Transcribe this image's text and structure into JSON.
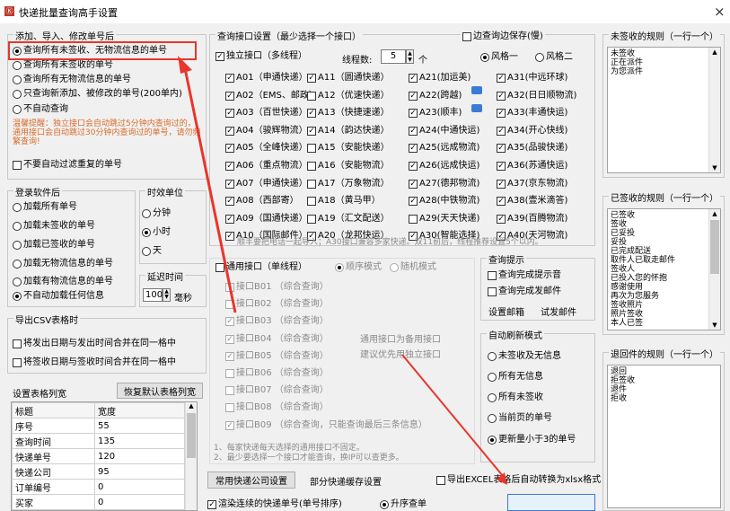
{
  "window": {
    "title": "快递批量查询高手设置",
    "close": "×"
  },
  "import": {
    "title": "添加、导入、修改单号后",
    "options": [
      {
        "label": "查询所有未签收、无物流信息的单号",
        "on": true
      },
      {
        "label": "查询所有未签收的单号",
        "on": false
      },
      {
        "label": "查询所有无物流信息的单号",
        "on": false
      },
      {
        "label": "只查询新添加、被修改的单号(200单内)",
        "on": false
      },
      {
        "label": "不自动查询",
        "on": false
      }
    ],
    "warning": "温馨提醒：独立接口会自动跳过5分钟内查询过的，通用接口会自动跳过30分钟内查询过的单号，请勿频繁查询!",
    "nofilter": "不要自动过滤重复的单号"
  },
  "login": {
    "title": "登录软件后",
    "options": [
      {
        "label": "加载所有单号",
        "on": false
      },
      {
        "label": "加载未签收的单号",
        "on": false
      },
      {
        "label": "加载已签收的单号",
        "on": false
      },
      {
        "label": "加载无物流信息的单号",
        "on": false
      },
      {
        "label": "加载有物流信息的单号",
        "on": false
      },
      {
        "label": "不自动加载任何信息",
        "on": true
      }
    ]
  },
  "time": {
    "title": "时效单位",
    "options": [
      {
        "label": "分钟",
        "on": false
      },
      {
        "label": "小时",
        "on": true
      },
      {
        "label": "天",
        "on": false
      }
    ]
  },
  "delay": {
    "title": "延迟时间",
    "value": "100",
    "unit": "毫秒"
  },
  "csv": {
    "title": "导出CSV表格时",
    "opt1": "将发出日期与发出时间合并在同一格中",
    "opt2": "将签收日期与签收时间合并在同一格中"
  },
  "cols": {
    "title": "设置表格列宽",
    "reset": "恢复默认表格列宽",
    "headers": [
      "标题",
      "宽度"
    ],
    "rows": [
      [
        "序号",
        "55"
      ],
      [
        "查询时间",
        "135"
      ],
      [
        "快递单号",
        "120"
      ],
      [
        "快递公司",
        "95"
      ],
      [
        "订单编号",
        "0"
      ],
      [
        "买家",
        "0"
      ]
    ]
  },
  "api": {
    "title": "查询接口设置（最少选择一个接口）",
    "edge": "边查询边保存(慢)",
    "indep": "独立接口（多线程）",
    "threads_label": "线程数:",
    "threads": "5",
    "threads_unit": "个",
    "style1": "风格一",
    "style2": "风格二",
    "cols": [
      [
        {
          "l": "A01（申通快递）",
          "c": true
        },
        {
          "l": "A02（EMS、邮政）",
          "c": true
        },
        {
          "l": "A03（百世快递）",
          "c": true
        },
        {
          "l": "A04（骏辉物流）",
          "c": true
        },
        {
          "l": "A05（全峰快递）",
          "c": true
        },
        {
          "l": "A06（重点物流）",
          "c": true
        },
        {
          "l": "A07（申通快递）",
          "c": true
        },
        {
          "l": "A08（西部寄）",
          "c": true
        },
        {
          "l": "A09（国通快递）",
          "c": true
        },
        {
          "l": "A10（国际邮件）",
          "c": true
        }
      ],
      [
        {
          "l": "A11（圆通快递）",
          "c": true
        },
        {
          "l": "A12（优速快递）",
          "c": false
        },
        {
          "l": "A13（快捷速递）",
          "c": true
        },
        {
          "l": "A14（韵达快递）",
          "c": true
        },
        {
          "l": "A15（安能快递）",
          "c": false
        },
        {
          "l": "A16（安能物流）",
          "c": false
        },
        {
          "l": "A17（万象物流）",
          "c": false
        },
        {
          "l": "A18（黄马甲）",
          "c": false
        },
        {
          "l": "A19（汇文配送）",
          "c": false
        },
        {
          "l": "A20（龙邦快运）",
          "c": true
        }
      ],
      [
        {
          "l": "A21(加运美)",
          "c": true
        },
        {
          "l": "A22(跨越)",
          "c": true
        },
        {
          "l": "A23(顺丰)",
          "c": true
        },
        {
          "l": "A24(中通快运)",
          "c": true
        },
        {
          "l": "A25(远成物流)",
          "c": true
        },
        {
          "l": "A26(远成快运)",
          "c": true
        },
        {
          "l": "A27(德邦物流)",
          "c": true
        },
        {
          "l": "A28(中铁物流)",
          "c": true
        },
        {
          "l": "A29(天天快递)",
          "c": false
        },
        {
          "l": "A30(智能选择)",
          "c": true
        }
      ],
      [
        {
          "l": "A31(中远环球)",
          "c": true
        },
        {
          "l": "A32(日日顺物流)",
          "c": true
        },
        {
          "l": "A33(丰通快运)",
          "c": true
        },
        {
          "l": "A34(开心快线)",
          "c": true
        },
        {
          "l": "A35(品骏快递)",
          "c": true
        },
        {
          "l": "A36(苏通快运)",
          "c": true
        },
        {
          "l": "A37(京东物流)",
          "c": true
        },
        {
          "l": "A38(壹米滴答)",
          "c": true
        },
        {
          "l": "A39(百腾物流)",
          "c": true
        },
        {
          "l": "A40(天河物流)",
          "c": true
        }
      ]
    ],
    "note": "顺丰要把电话一起导入；A30接口兼容多家快递。双11前后，线程推荐设置5个以内。"
  },
  "general": {
    "title": "通用接口（单线程）",
    "mode1": "顺序模式",
    "mode2": "随机模式",
    "items": [
      {
        "l": "接口B01 （综合查询）",
        "c": false
      },
      {
        "l": "接口B02 （综合查询）",
        "c": false
      },
      {
        "l": "接口B03 （综合查询）",
        "c": true
      },
      {
        "l": "接口B04 （综合查询）",
        "c": true
      },
      {
        "l": "接口B05 （综合查询）",
        "c": true
      },
      {
        "l": "接口B06 （综合查询）",
        "c": false
      },
      {
        "l": "接口B07 （综合查询）",
        "c": false
      },
      {
        "l": "接口B08 （综合查询）",
        "c": false
      },
      {
        "l": "接口B09 （综合查询，只能查询最后三条信息）",
        "c": true
      }
    ],
    "tip1": "通用接口为备用接口",
    "tip2": "建议优先用独立接口",
    "foot1": "1、每家快递每天选择的通用接口不固定。",
    "foot2": "2、最少要选择一个接口才能查询，换IP可以查更多。"
  },
  "hint": {
    "title": "查询提示",
    "opt1": "查询完成提示音",
    "opt2": "查询完成发邮件",
    "btn1": "设置邮箱",
    "btn2": "试发邮件"
  },
  "auto": {
    "title": "自动刷新模式",
    "options": [
      {
        "label": "未签收及无信息",
        "on": false
      },
      {
        "label": "所有无信息",
        "on": false
      },
      {
        "label": "所有未签收",
        "on": false
      },
      {
        "label": "当前页的单号",
        "on": false
      },
      {
        "label": "更新量小于3的单号",
        "on": true
      }
    ]
  },
  "bottom": {
    "btn_common": "常用快递公司设置",
    "partial": "部分快递缓存设置",
    "excel": "导出EXCEL表格后自动转换为xlsx格式",
    "render": "渲染连续的快递单号(单号排序)",
    "asc": "升序查单"
  },
  "rules_unsigned": {
    "title": "未签收的规则（一行一个）",
    "lines": [
      "未签收",
      "正在派件",
      "为您派件"
    ]
  },
  "rules_signed": {
    "title": "已签收的规则（一行一个）",
    "lines": [
      "已签收",
      "签收",
      "已妥投",
      "妥投",
      "已完成配送",
      "取件人已取走邮件",
      "签收人",
      "已投入您的怀抱",
      "感谢使用",
      "再次为您服务",
      "签收照片",
      "照片签收",
      "本人已签"
    ]
  },
  "rules_return": {
    "title": "退回件的规则（一行一个）",
    "lines": [
      "退回",
      "拒签收",
      "退件",
      "拒收"
    ]
  }
}
